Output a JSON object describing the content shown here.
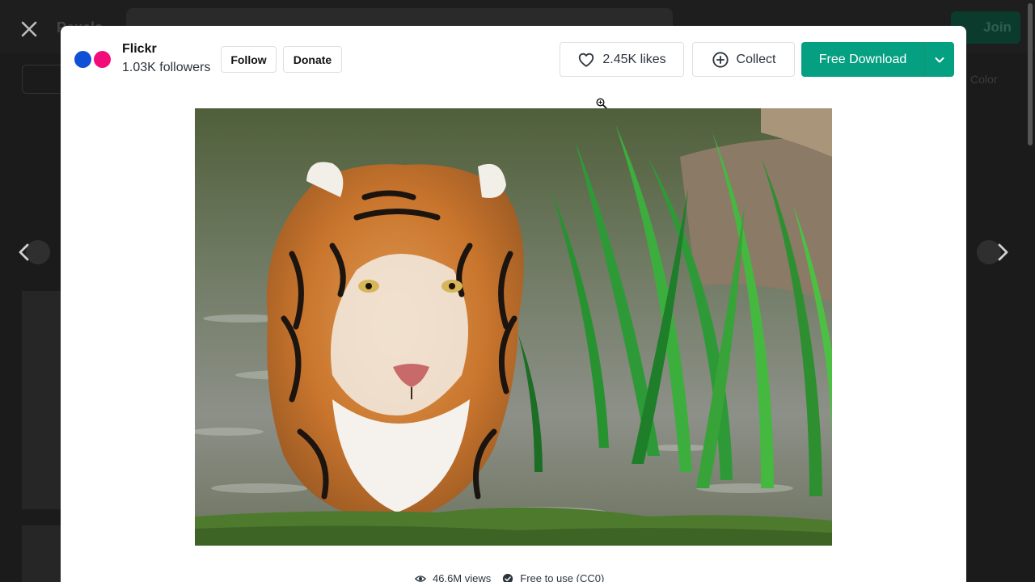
{
  "background": {
    "logo": "Pexels",
    "join_label": "Join",
    "color_label": "Color"
  },
  "author": {
    "name": "Flickr",
    "followers": "1.03K followers",
    "logo_colors": [
      "#0f50d6",
      "#f20c7a"
    ]
  },
  "actions": {
    "follow_label": "Follow",
    "donate_label": "Donate",
    "likes_label": "2.45K likes",
    "collect_label": "Collect",
    "download_label": "Free Download"
  },
  "photo": {
    "subject": "tiger walking through water beside green grass"
  },
  "meta": {
    "views": "46.6M views",
    "license": "Free to use (CC0)"
  },
  "icons": [
    "close-icon",
    "chevron-left-icon",
    "chevron-right-icon",
    "heart-icon",
    "plus-circle-icon",
    "chevron-down-icon",
    "zoom-in-icon",
    "eye-icon",
    "check-circle-icon"
  ],
  "colors": {
    "accent": "#05a081",
    "text": "#2c343e",
    "overlay": "#1b1b1b"
  }
}
